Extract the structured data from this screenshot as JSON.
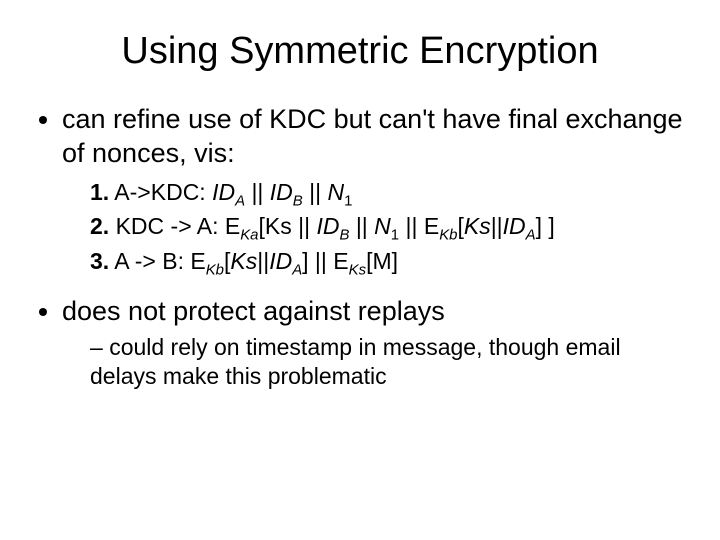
{
  "title": "Using Symmetric Encryption",
  "bullet1": "can refine use of KDC but can't have final exchange of nonces, vis:",
  "steps": {
    "s1": {
      "num": "1.",
      "prefix": " A->KDC: ",
      "body_html": "<span class='it'>ID<sub>A</sub></span> || <span class='it'>ID<sub>B</sub></span> || <span class='it'>N<sub class='n'>1</sub></span>"
    },
    "s2": {
      "num": "2.",
      "prefix": " KDC -> A: ",
      "body_html": "E<sub>Ka</sub>[Ks || <span class='it'>ID<sub>B</sub></span> || <span class='it'>N<sub class='n'>1</sub></span> || E<sub>Kb</sub>[<span class='it'>Ks</span>||<span class='it'>ID<sub>A</sub></span>] ]"
    },
    "s3": {
      "num": "3.",
      "prefix": " A -> B: ",
      "body_html": "E<sub>Kb</sub>[<span class='it'>Ks</span>||<span class='it'>ID<sub>A</sub></span>] || E<sub>Ks</sub>[M]"
    }
  },
  "bullet2": "does not protect against replays",
  "sub2": "could rely on timestamp in message, though email delays make this problematic"
}
